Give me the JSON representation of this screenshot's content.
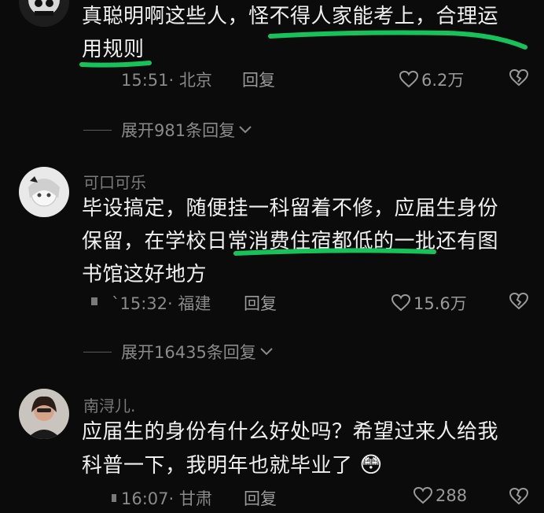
{
  "comments": [
    {
      "username": "",
      "lines": [
        "真聪明啊这些人，怪不得人家能考上，合理运",
        "用规则"
      ],
      "time": "15:51· 北京",
      "reply_label": "回复",
      "likes": "6.2万",
      "expand_label": "展开981条回复"
    },
    {
      "username": "可口可乐",
      "lines": [
        "毕设搞定，随便挂一科留着不修，应届生身份",
        "保留，在学校日常消费住宿都低的一批还有图",
        "书馆这好地方"
      ],
      "time": "`15:32· 福建",
      "reply_label": "回复",
      "likes": "15.6万",
      "expand_label": "展开16435条回复"
    },
    {
      "username": "南浔儿.",
      "lines": [
        "应届生的身份有什么好处吗？希望过来人给我",
        "科普一下，我明年也就毕业了"
      ],
      "emoji": "😳",
      "time": "16:07· 甘肃",
      "reply_label": "回复",
      "likes": "288"
    }
  ],
  "colors": {
    "background": "#0b0b0b",
    "text": "#f0f0f0",
    "meta": "#8a8a8a",
    "highlight": "#18c25a"
  },
  "icons": {
    "like": "heart-outline-icon",
    "dislike": "broken-heart-icon",
    "expand": "chevron-down-icon"
  }
}
